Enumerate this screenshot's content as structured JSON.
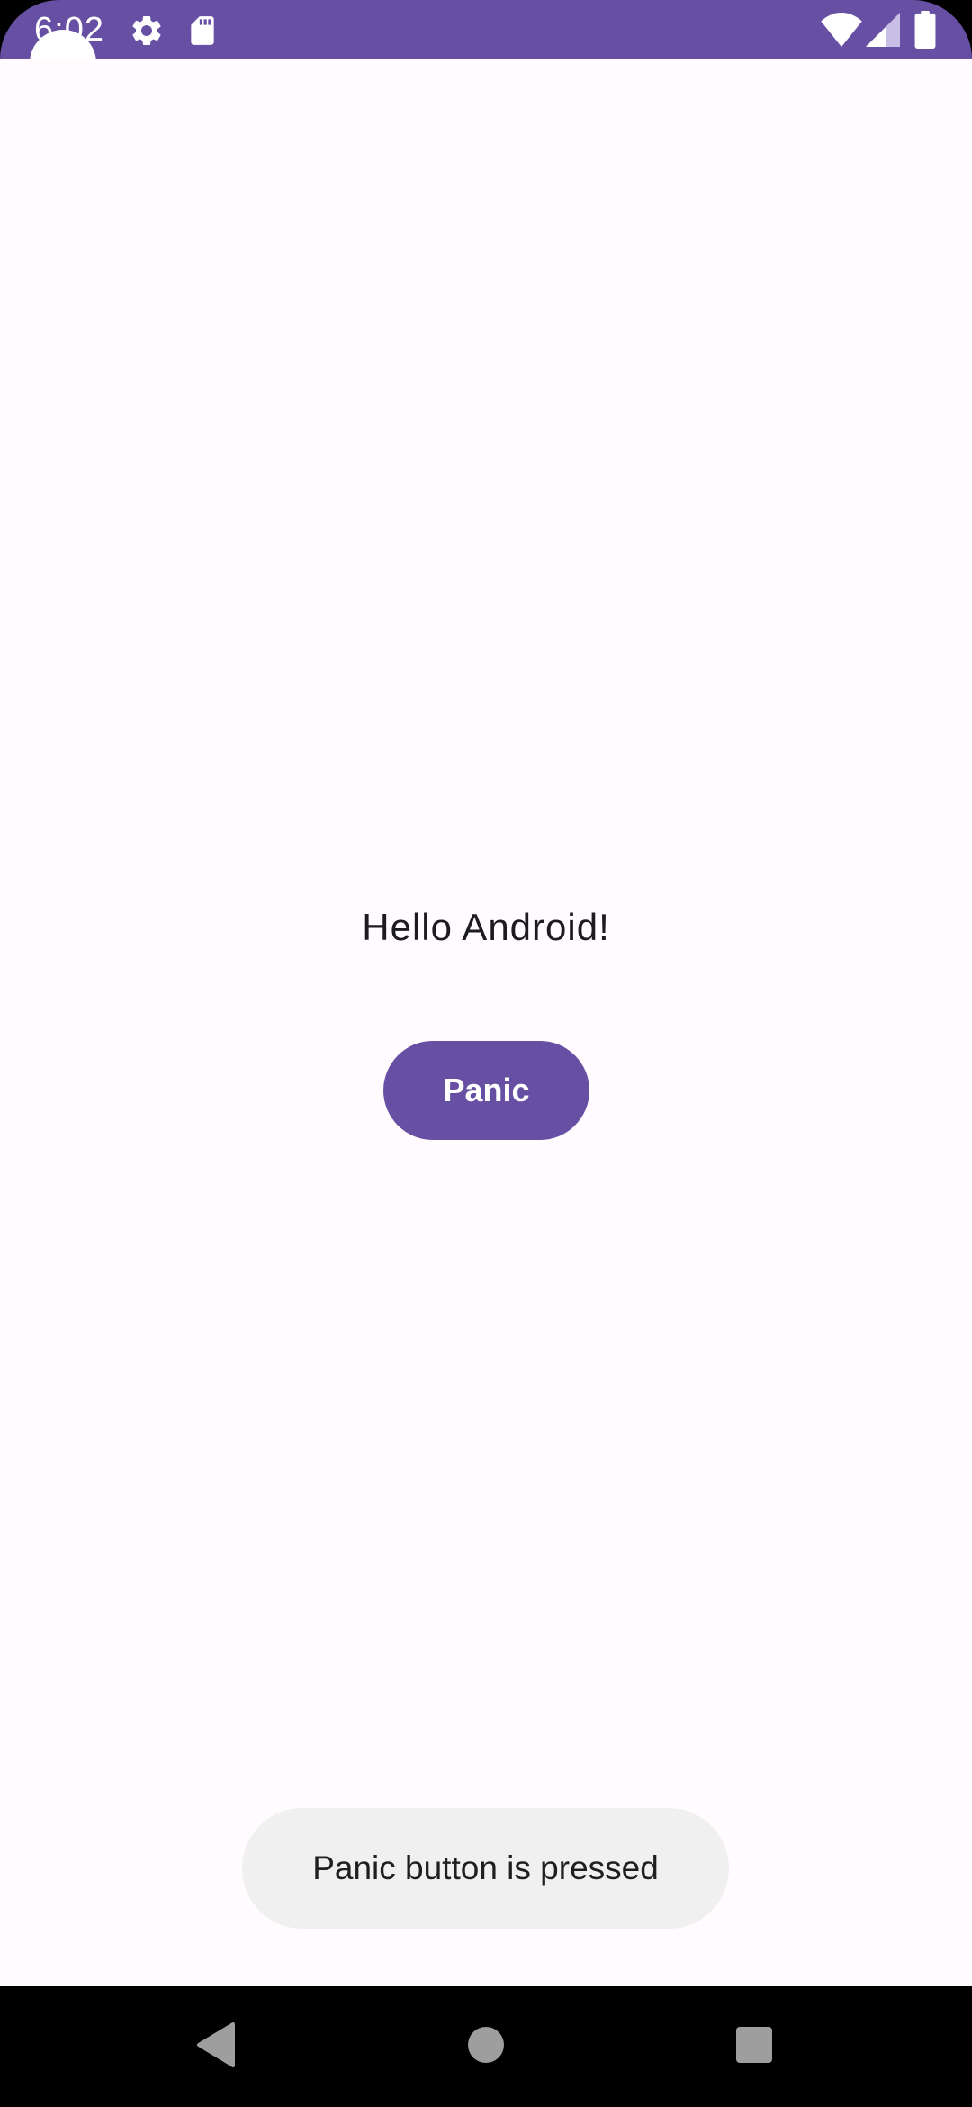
{
  "status_bar": {
    "time": "6:02",
    "icons": [
      "settings-icon",
      "sd-card-icon",
      "wifi-icon",
      "signal-icon",
      "battery-icon"
    ],
    "color": "#6750a4"
  },
  "app": {
    "greeting": "Hello Android!",
    "panic_button_label": "Panic",
    "accent_color": "#6750a4",
    "background_color": "#fffbfe"
  },
  "toast": {
    "message": "Panic button is pressed"
  },
  "navigation": {
    "buttons": [
      "back-icon",
      "home-icon",
      "recents-icon"
    ]
  }
}
